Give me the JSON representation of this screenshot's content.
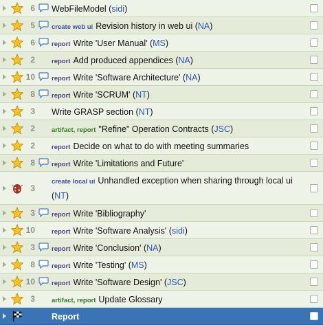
{
  "colors": {
    "row_bg": "#eef3e7",
    "row_bg_alt": "#e4ecd9",
    "selected_bg": "#3b74b4",
    "tag_ui": "#3d4ea8",
    "tag_report": "#4a3f78",
    "tag_artifact": "#2f7a24",
    "owner_link": "#2c55b9"
  },
  "rows": [
    {
      "icon": "star-icon",
      "count": "6",
      "comment": true,
      "tags": "",
      "tag_type": "",
      "title": "WebFileModel",
      "owner": "sidi"
    },
    {
      "icon": "star-icon",
      "count": "5",
      "comment": true,
      "tags": "create web ui",
      "tag_type": "ui",
      "title": "Revision history in web ui",
      "owner": "NA"
    },
    {
      "icon": "star-icon",
      "count": "6",
      "comment": true,
      "tags": "report",
      "tag_type": "report",
      "title": "Write 'User Manual'",
      "owner": "MS"
    },
    {
      "icon": "star-icon",
      "count": "2",
      "comment": false,
      "tags": "report",
      "tag_type": "report",
      "title": "Add produced appendices",
      "owner": "NA"
    },
    {
      "icon": "star-icon",
      "count": "10",
      "comment": true,
      "tags": "report",
      "tag_type": "report",
      "title": "Write 'Software Architecture'",
      "owner": "NA"
    },
    {
      "icon": "star-icon",
      "count": "8",
      "comment": true,
      "tags": "report",
      "tag_type": "report",
      "title": "Write 'SCRUM'",
      "owner": "NT"
    },
    {
      "icon": "star-icon",
      "count": "3",
      "comment": false,
      "tags": "",
      "tag_type": "",
      "title": "Write GRASP section",
      "owner": "NT"
    },
    {
      "icon": "star-icon",
      "count": "2",
      "comment": false,
      "tags": "artifact, report",
      "tag_type": "artifact",
      "title": "\"Refine\" Operation Contracts",
      "owner": "JSC"
    },
    {
      "icon": "star-icon",
      "count": "2",
      "comment": false,
      "tags": "report",
      "tag_type": "report",
      "title": "Decide on what to do with meeting summaries",
      "owner": ""
    },
    {
      "icon": "star-icon",
      "count": "8",
      "comment": true,
      "tags": "report",
      "tag_type": "report",
      "title": "Write 'Limitations and Future'",
      "owner": ""
    },
    {
      "icon": "bug-icon",
      "count": "3",
      "comment": false,
      "tags": "create local ui",
      "tag_type": "ui",
      "title": "Unhandled exception when sharing through local ui",
      "owner": "NT"
    },
    {
      "icon": "star-icon",
      "count": "3",
      "comment": true,
      "tags": "report",
      "tag_type": "report",
      "title": "Write 'Bibliography'",
      "owner": ""
    },
    {
      "icon": "star-icon",
      "count": "10",
      "comment": false,
      "tags": "report",
      "tag_type": "report",
      "title": "Write 'Software Analysis'",
      "owner": "sidi"
    },
    {
      "icon": "star-icon",
      "count": "3",
      "comment": true,
      "tags": "report",
      "tag_type": "report",
      "title": "Write 'Conclusion'",
      "owner": "NA"
    },
    {
      "icon": "star-icon",
      "count": "8",
      "comment": true,
      "tags": "report",
      "tag_type": "report",
      "title": "Write 'Testing'",
      "owner": "MS"
    },
    {
      "icon": "star-icon",
      "count": "10",
      "comment": true,
      "tags": "report",
      "tag_type": "report",
      "title": "Write 'Software Design'",
      "owner": "JSC"
    },
    {
      "icon": "star-icon",
      "count": "3",
      "comment": false,
      "tags": "artifact, report",
      "tag_type": "artifact",
      "title": "Update Glossary",
      "owner": ""
    },
    {
      "icon": "flag-icon",
      "count": "",
      "comment": false,
      "tags": "",
      "tag_type": "",
      "title": "Report",
      "owner": "",
      "selected": true
    }
  ]
}
